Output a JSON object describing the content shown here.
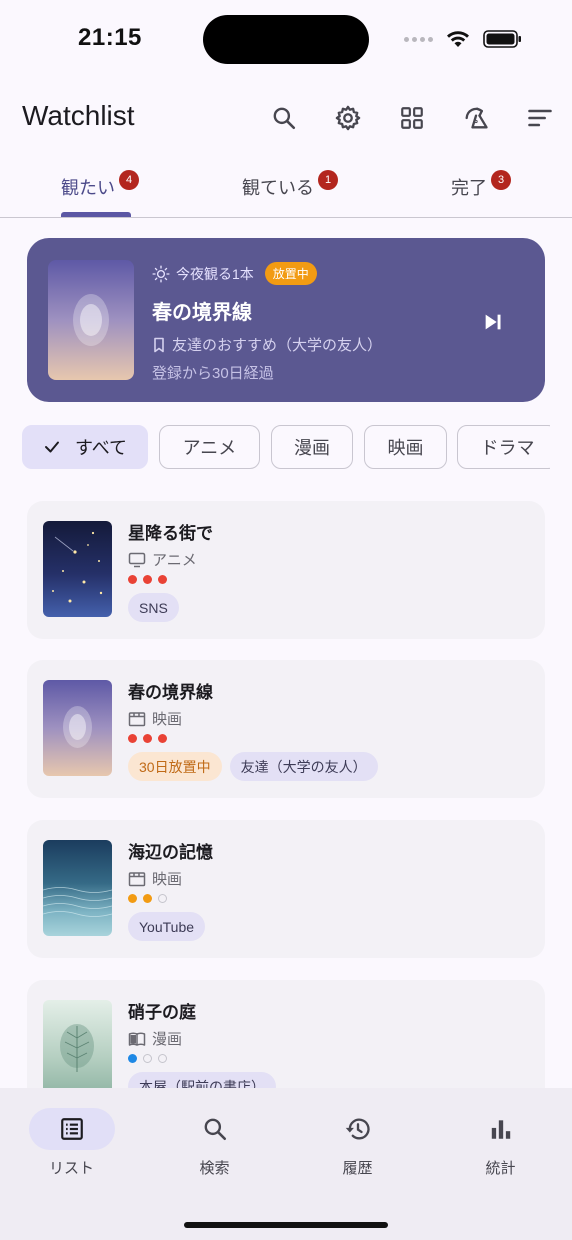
{
  "status_bar": {
    "time": "21:15"
  },
  "app_bar": {
    "title": "Watchlist",
    "actions": [
      "search-icon",
      "gear-icon",
      "grid-icon",
      "shuffle-icon",
      "sort-icon"
    ]
  },
  "tabs": [
    {
      "label": "観たい",
      "badge": "4",
      "active": true
    },
    {
      "label": "観ている",
      "badge": "1",
      "active": false
    },
    {
      "label": "完了",
      "badge": "3",
      "active": false
    }
  ],
  "hero": {
    "meta_label": "今夜観る1本",
    "badge": "放置中",
    "title": "春の境界線",
    "recommendation": "友達のおすすめ（大学の友人）",
    "elapsed": "登録から30日経過",
    "colors": {
      "background": "#5b5891",
      "badge": "#f29b13"
    }
  },
  "filters": [
    {
      "label": "すべて",
      "selected": true
    },
    {
      "label": "アニメ",
      "selected": false
    },
    {
      "label": "漫画",
      "selected": false
    },
    {
      "label": "映画",
      "selected": false
    },
    {
      "label": "ドラマ",
      "selected": false
    }
  ],
  "items": [
    {
      "title": "星降る街で",
      "type": "アニメ",
      "type_icon": "tv-icon",
      "priority": {
        "filled": 3,
        "total": 3,
        "color": "#e94235"
      },
      "tags": [
        {
          "label": "SNS",
          "style": "normal"
        }
      ]
    },
    {
      "title": "春の境界線",
      "type": "映画",
      "type_icon": "clapperboard-icon",
      "priority": {
        "filled": 3,
        "total": 3,
        "color": "#e94235"
      },
      "tags": [
        {
          "label": "30日放置中",
          "style": "warn"
        },
        {
          "label": "友達（大学の友人）",
          "style": "normal"
        }
      ]
    },
    {
      "title": "海辺の記憶",
      "type": "映画",
      "type_icon": "clapperboard-icon",
      "priority": {
        "filled": 2,
        "total": 3,
        "color": "#f29b13"
      },
      "tags": [
        {
          "label": "YouTube",
          "style": "normal"
        }
      ]
    },
    {
      "title": "硝子の庭",
      "type": "漫画",
      "type_icon": "book-icon",
      "priority": {
        "filled": 1,
        "total": 3,
        "color": "#1e88e5"
      },
      "tags": [
        {
          "label": "本屋（駅前の書店）",
          "style": "normal"
        }
      ]
    }
  ],
  "bottom_nav": [
    {
      "label": "リスト",
      "icon": "list-icon",
      "active": true
    },
    {
      "label": "検索",
      "icon": "search-icon",
      "active": false
    },
    {
      "label": "履歴",
      "icon": "history-icon",
      "active": false
    },
    {
      "label": "統計",
      "icon": "bar-chart-icon",
      "active": false
    }
  ]
}
